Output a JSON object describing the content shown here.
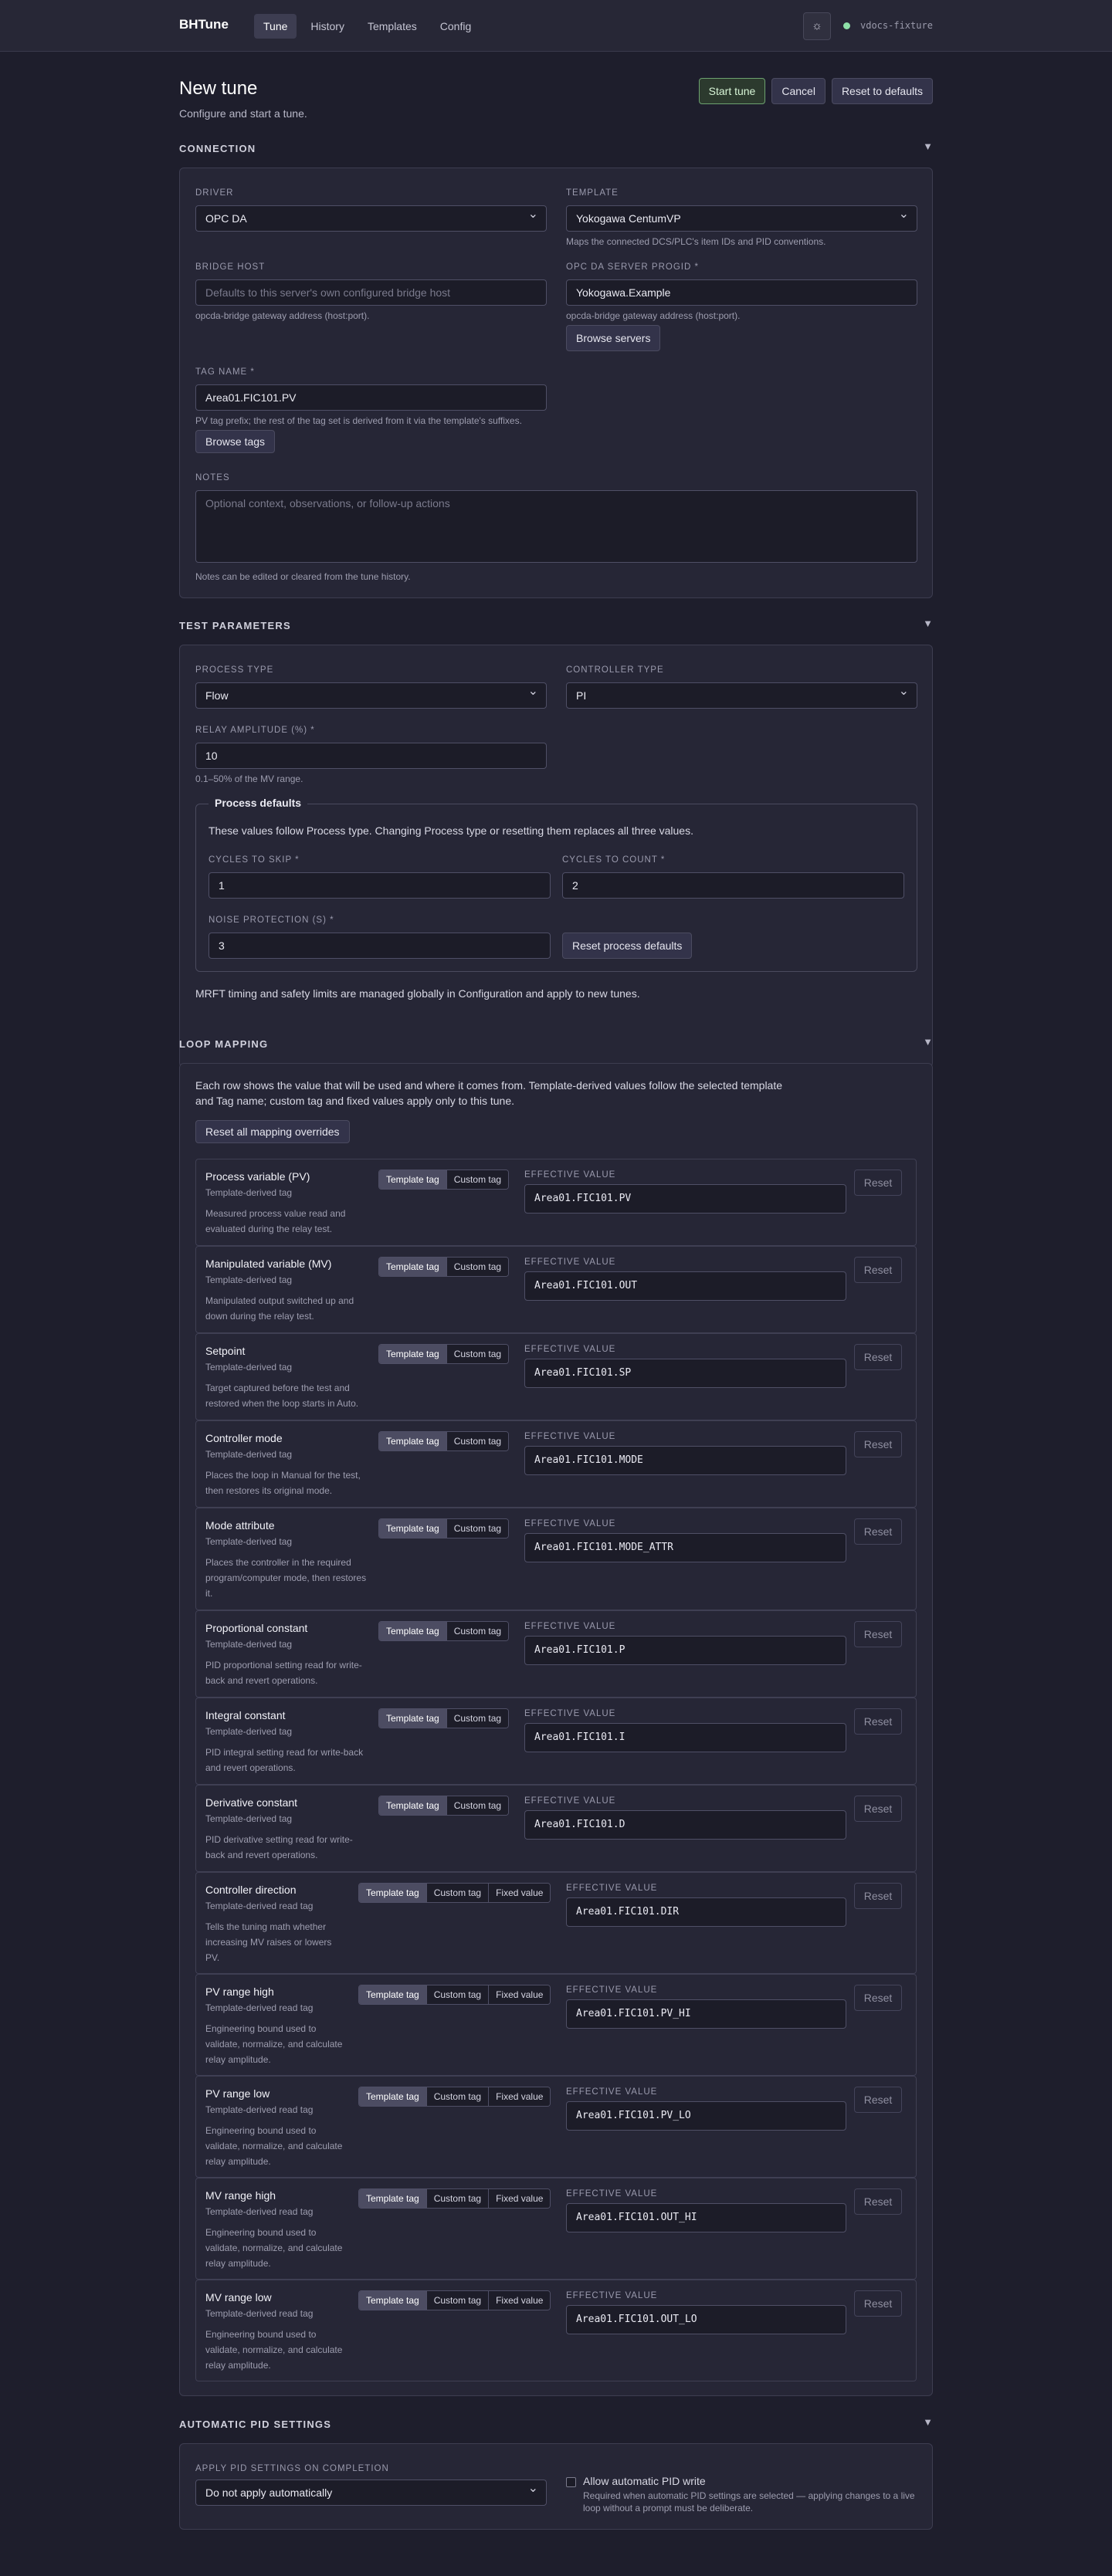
{
  "app": {
    "brand": "BHTune",
    "status_text": "vdocs-fixture",
    "theme_icon": "sun-icon"
  },
  "nav": {
    "tabs": [
      "Tune",
      "History",
      "Templates",
      "Config"
    ],
    "active": "Tune"
  },
  "header": {
    "title": "New tune",
    "subtitle": "Configure and start a tune.",
    "start_label": "Start tune",
    "cancel_label": "Cancel",
    "reset_label": "Reset to defaults"
  },
  "connection": {
    "title": "CONNECTION",
    "driver_label": "DRIVER",
    "driver_value": "OPC DA",
    "template_label": "TEMPLATE",
    "template_value": "Yokogawa CentumVP",
    "template_help": "Maps the connected DCS/PLC's item IDs and PID conventions.",
    "bridge_label": "BRIDGE HOST",
    "bridge_placeholder": "Defaults to this server's own configured bridge host",
    "bridge_help": "opcda-bridge gateway address (host:port).",
    "progid_label": "OPC DA SERVER PROGID *",
    "progid_value": "Yokogawa.Example",
    "progid_help": "opcda-bridge gateway address (host:port).",
    "browse_servers_label": "Browse servers",
    "tag_label": "TAG NAME *",
    "tag_value": "Area01.FIC101.PV",
    "tag_help": "PV tag prefix; the rest of the tag set is derived from it via the template's suffixes.",
    "browse_tags_label": "Browse tags",
    "notes_label": "NOTES",
    "notes_placeholder": "Optional context, observations, or follow-up actions",
    "notes_help": "Notes can be edited or cleared from the tune history."
  },
  "test_params": {
    "title": "TEST PARAMETERS",
    "process_label": "PROCESS TYPE",
    "process_value": "Flow",
    "controller_label": "CONTROLLER TYPE",
    "controller_value": "PI",
    "relay_label": "RELAY AMPLITUDE (%) *",
    "relay_value": "10",
    "relay_help": "0.1–50% of the MV range.",
    "defaults_legend": "Process defaults",
    "defaults_text": "These values follow Process type. Changing Process type or resetting them replaces all three values.",
    "skip_label": "CYCLES TO SKIP *",
    "skip_value": "1",
    "count_label": "CYCLES TO COUNT *",
    "count_value": "2",
    "noise_label": "NOISE PROTECTION (S) *",
    "noise_value": "3",
    "reset_defaults_label": "Reset process defaults",
    "footer_text": "MRFT timing and safety limits are managed globally in Configuration and apply to new tunes."
  },
  "loop_mapping": {
    "title": "LOOP MAPPING",
    "intro_1": "Each row shows the value that will be used and where it comes from. Template-derived values follow the selected template",
    "intro_2": "and Tag name; custom tag and fixed values apply only to this tune.",
    "reset_all_label": "Reset all mapping overrides",
    "effective_label": "EFFECTIVE VALUE",
    "reset_label": "Reset",
    "seg_template": "Template tag",
    "seg_custom": "Custom tag",
    "seg_fixed": "Fixed value",
    "rows": [
      {
        "name": "Process variable (PV)",
        "source": "Template-derived tag",
        "desc": [
          "Measured process value read and",
          "evaluated during the relay test."
        ],
        "value": "Area01.FIC101.PV"
      },
      {
        "name": "Manipulated variable (MV)",
        "source": "Template-derived tag",
        "desc": [
          "Manipulated output switched up and",
          "down during the relay test."
        ],
        "value": "Area01.FIC101.OUT"
      },
      {
        "name": "Setpoint",
        "source": "Template-derived tag",
        "desc": [
          "Target captured before the test and",
          "restored when the loop starts in Auto."
        ],
        "value": "Area01.FIC101.SP"
      },
      {
        "name": "Controller mode",
        "source": "Template-derived tag",
        "desc": [
          "Places the loop in Manual for the test,",
          "then restores its original mode."
        ],
        "value": "Area01.FIC101.MODE"
      },
      {
        "name": "Mode attribute",
        "source": "Template-derived tag",
        "desc": [
          "Places the controller in the required",
          "program/computer mode, then restores",
          "it."
        ],
        "value": "Area01.FIC101.MODE_ATTR"
      },
      {
        "name": "Proportional constant",
        "source": "Template-derived tag",
        "desc": [
          "PID proportional setting read for write-",
          "back and revert operations."
        ],
        "value": "Area01.FIC101.P"
      },
      {
        "name": "Integral constant",
        "source": "Template-derived tag",
        "desc": [
          "PID integral setting read for write-back",
          "and revert operations."
        ],
        "value": "Area01.FIC101.I"
      },
      {
        "name": "Derivative constant",
        "source": "Template-derived tag",
        "desc": [
          "PID derivative setting read for write-",
          "back and revert operations."
        ],
        "value": "Area01.FIC101.D"
      },
      {
        "name": "Controller direction",
        "source": "Template-derived read tag",
        "desc": [
          "Tells the tuning math whether",
          "increasing MV raises or lowers",
          "PV."
        ],
        "value": "Area01.FIC101.DIR"
      },
      {
        "name": "PV range high",
        "source": "Template-derived read tag",
        "desc": [
          "Engineering bound used to",
          "validate, normalize, and calculate",
          "relay amplitude."
        ],
        "value": "Area01.FIC101.PV_HI"
      },
      {
        "name": "PV range low",
        "source": "Template-derived read tag",
        "desc": [
          "Engineering bound used to",
          "validate, normalize, and calculate",
          "relay amplitude."
        ],
        "value": "Area01.FIC101.PV_LO"
      },
      {
        "name": "MV range high",
        "source": "Template-derived read tag",
        "desc": [
          "Engineering bound used to",
          "validate, normalize, and calculate",
          "relay amplitude."
        ],
        "value": "Area01.FIC101.OUT_HI"
      },
      {
        "name": "MV range low",
        "source": "Template-derived read tag",
        "desc": [
          "Engineering bound used to",
          "validate, normalize, and calculate",
          "relay amplitude."
        ],
        "value": "Area01.FIC101.OUT_LO"
      }
    ]
  },
  "auto_pid": {
    "title": "AUTOMATIC PID SETTINGS",
    "apply_label": "APPLY PID SETTINGS ON COMPLETION",
    "apply_value": "Do not apply automatically",
    "allow_label": "Allow automatic PID write",
    "allow_help_1": "Required when automatic PID settings are selected — applying changes to a live",
    "allow_help_2": "loop without a prompt must be deliberate."
  }
}
